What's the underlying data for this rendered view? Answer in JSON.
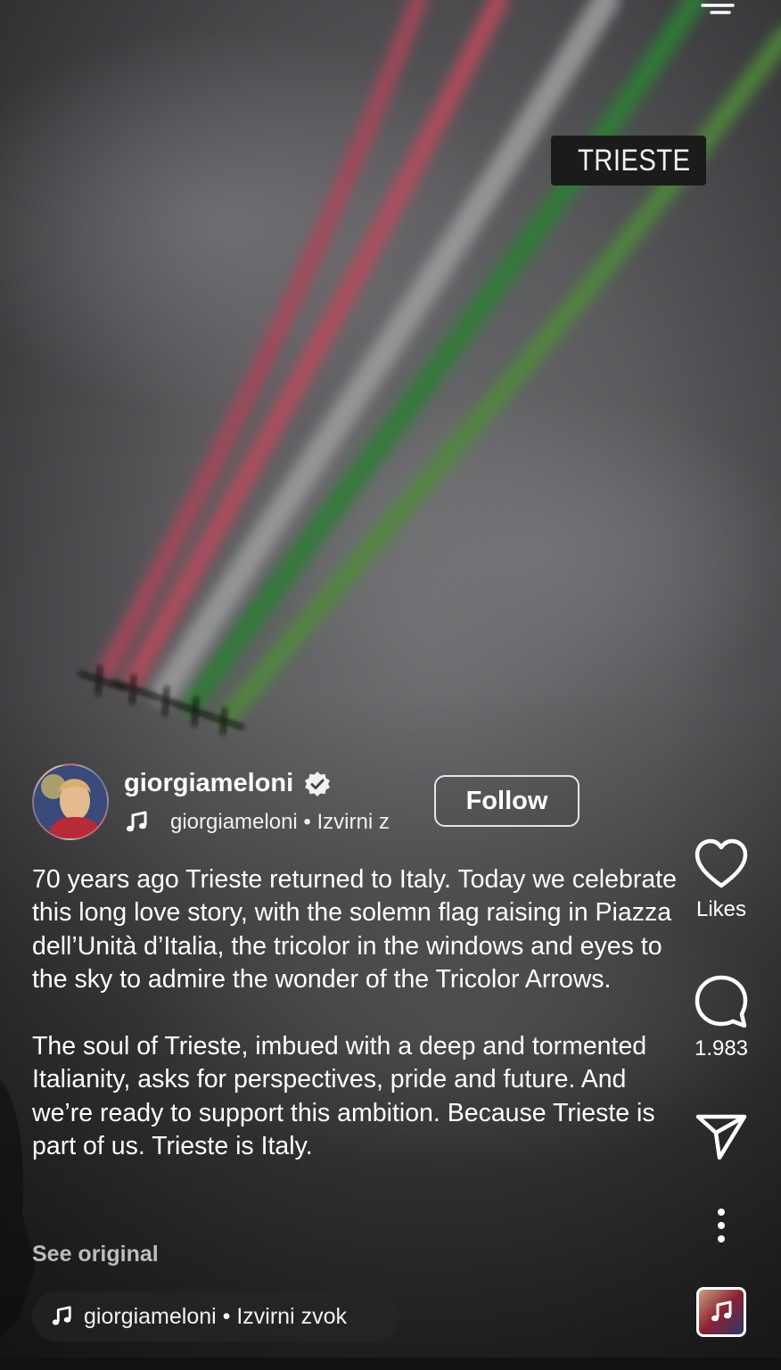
{
  "location": {
    "label": "TRIESTE",
    "icon": "location-pin-icon"
  },
  "author": {
    "username": "giorgiameloni",
    "verified_icon": "verified-badge-icon",
    "audio_line": "giorgiameloni • Izvirni z",
    "follow_label": "Follow"
  },
  "caption": {
    "paragraph1": "70 years ago Trieste returned to Italy. Today we celebrate this long love story, with the solemn flag raising in Piazza dell’Unità d’Italia, the tricolor in the windows and eyes to the sky to admire the wonder of the Tricolor Arrows.",
    "paragraph2": "The soul of Trieste, imbued with a deep and tormented Italianity, asks for perspectives, pride and future. And we’re ready to support this ambition. Because Trieste is part of us. Trieste is Italy.",
    "see_original": "See original"
  },
  "audio_pill": {
    "label": "giorgiameloni • Izvirni zvok"
  },
  "actions": {
    "likes_label": "Likes",
    "comments_count": "1.983"
  },
  "colors": {
    "smoke_red": "#b0404e",
    "smoke_white": "#9a9a9a",
    "smoke_green": "#2f7a32"
  }
}
